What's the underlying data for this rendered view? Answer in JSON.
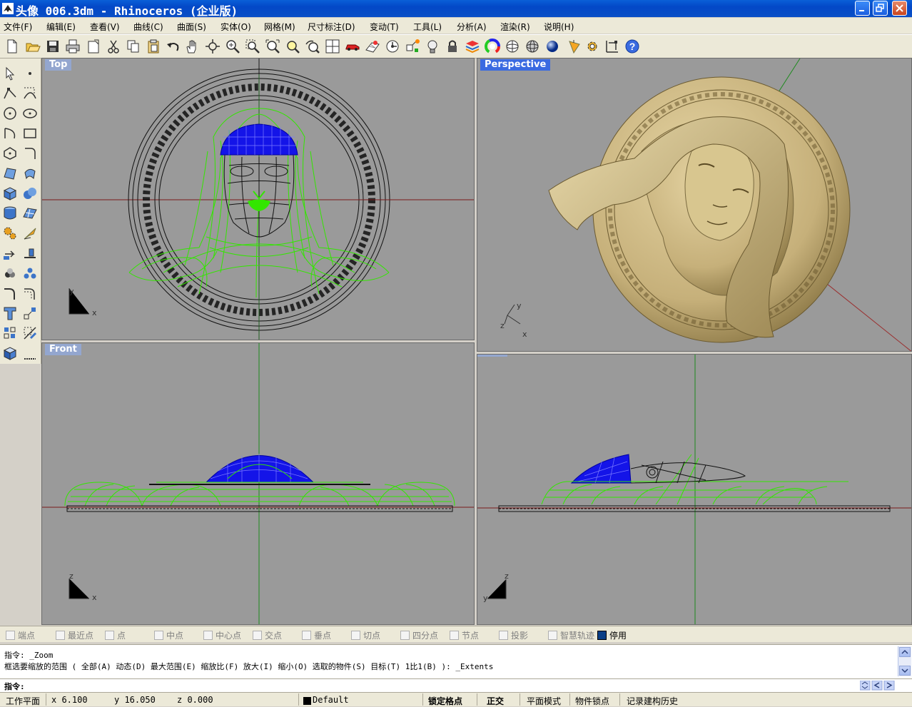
{
  "window": {
    "title": "头像 006.3dm - Rhinoceros (企业版)"
  },
  "menu": [
    "文件(F)",
    "编辑(E)",
    "查看(V)",
    "曲线(C)",
    "曲面(S)",
    "实体(O)",
    "网格(M)",
    "尺寸标注(D)",
    "变动(T)",
    "工具(L)",
    "分析(A)",
    "渲染(R)",
    "说明(H)"
  ],
  "toolbar_icons": [
    "new-file-icon",
    "open-folder-icon",
    "save-icon",
    "print-icon",
    "import-icon",
    "cut-icon",
    "copy-icon",
    "paste-icon",
    "undo-icon",
    "pan-hand-icon",
    "rotate-view-icon",
    "zoom-icon",
    "zoom-window-icon",
    "zoom-extents-icon",
    "zoom-selected-icon",
    "undo-view-icon",
    "four-viewports-icon",
    "car-icon",
    "grid-options-icon",
    "cplane-icon",
    "object-snap-icon",
    "light-bulb-icon",
    "lock-icon",
    "layer-icon",
    "color-wheel-icon",
    "wireframe-icon",
    "shaded-icon",
    "rendered-sphere-icon",
    "render-icon",
    "gear-options-icon",
    "dimension-icon",
    "help-icon"
  ],
  "viewports": {
    "top": {
      "label": "Top",
      "axis1": "y",
      "axis2": "x"
    },
    "perspective": {
      "label": "Perspective",
      "axis1": "y",
      "axis2": "x",
      "axis3": "z"
    },
    "front": {
      "label": "Front",
      "axis1": "z",
      "axis2": "x"
    },
    "right": {
      "axis1": "z",
      "axis2": "y"
    }
  },
  "osnaps": [
    {
      "label": "端点",
      "on": false
    },
    {
      "label": "最近点",
      "on": false
    },
    {
      "label": "点",
      "on": false
    },
    {
      "label": "中点",
      "on": false
    },
    {
      "label": "中心点",
      "on": false
    },
    {
      "label": "交点",
      "on": false
    },
    {
      "label": "垂点",
      "on": false
    },
    {
      "label": "切点",
      "on": false
    },
    {
      "label": "四分点",
      "on": false
    },
    {
      "label": "节点",
      "on": false
    },
    {
      "label": "投影",
      "on": false
    },
    {
      "label": "智慧轨迹",
      "on": false
    },
    {
      "label": "停用",
      "on": true
    }
  ],
  "command": {
    "history1": "指令: _Zoom",
    "history2": "框选要缩放的范围 ( 全部(A)  动态(D)  最大范围(E)  缩放比(F)  放大(I)  缩小(O)  选取的物件(S)  目标(T)  1比1(B) ): _Extents",
    "prompt": "指令:"
  },
  "status": {
    "cplane": "工作平面",
    "x": "x 6.100",
    "y": "y 16.050",
    "z": "z 0.000",
    "layer": "Default",
    "grid_snap": "锁定格点",
    "ortho": "正交",
    "planar": "平面模式",
    "osnap": "物件锁点",
    "history": "记录建构历史"
  },
  "colors": {
    "wire_green": "#22e000",
    "wire_blue": "#0a18e0",
    "viewport_bg": "#9a9a9a",
    "gold": "#c8b47c"
  }
}
